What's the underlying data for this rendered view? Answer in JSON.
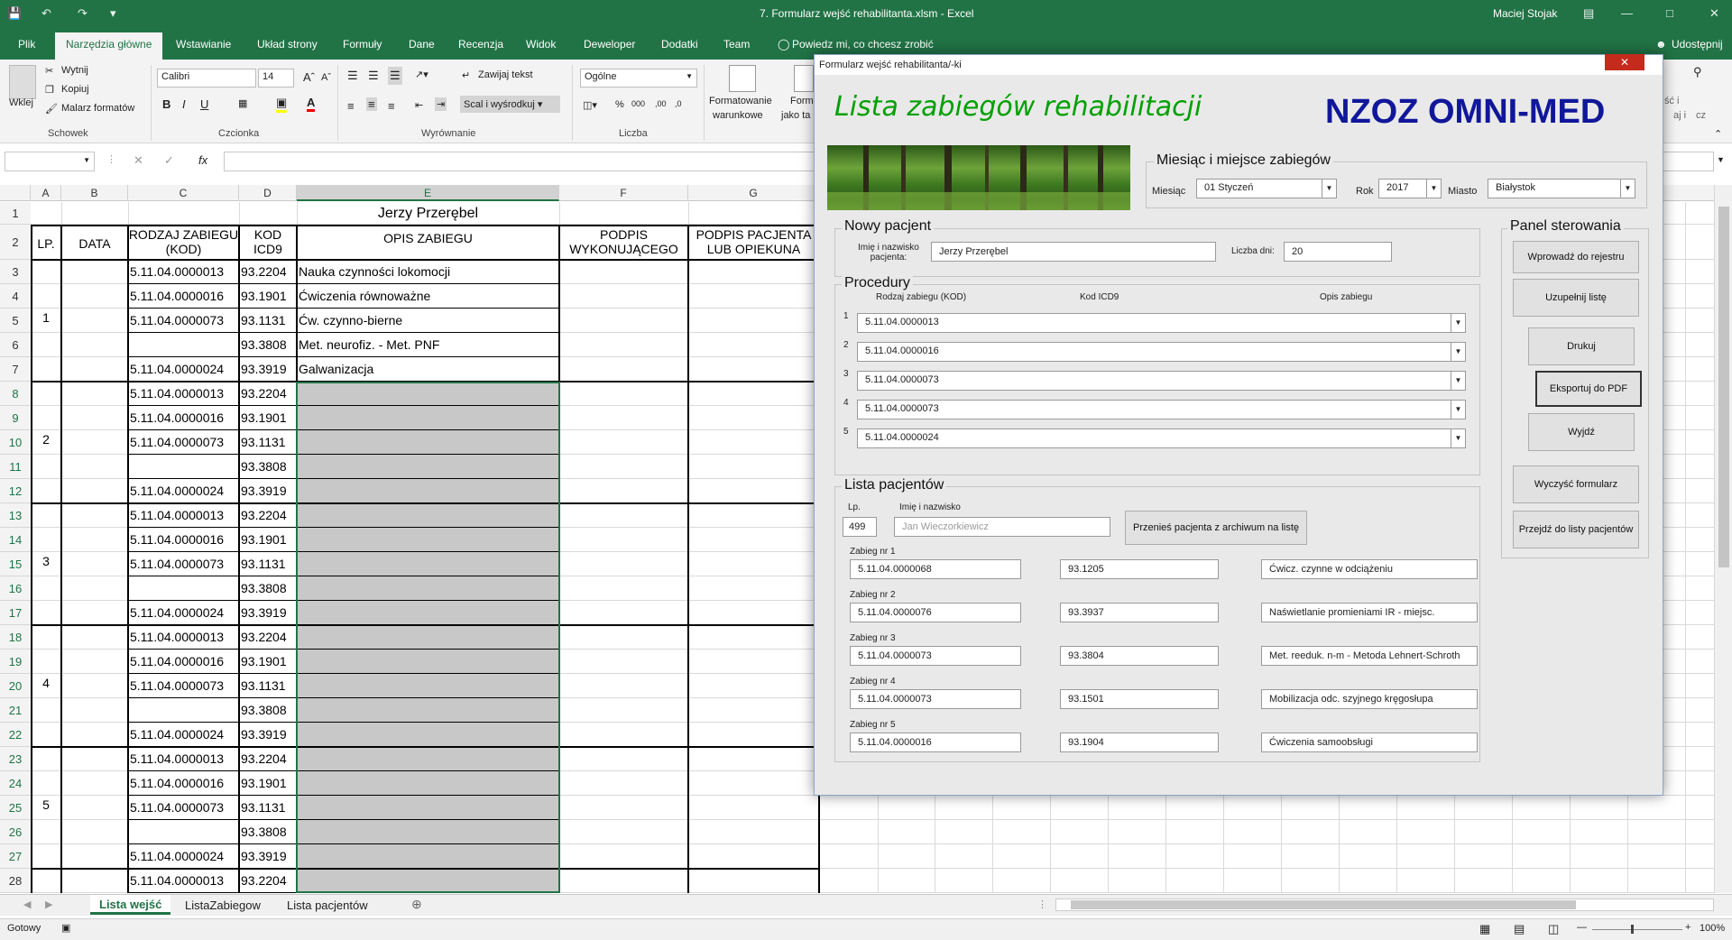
{
  "window": {
    "title": "7. Formularz wejść rehabilitanta.xlsm  -  Excel",
    "user": "Maciej Stojak"
  },
  "tabs": [
    "Plik",
    "Narzędzia główne",
    "Wstawianie",
    "Układ strony",
    "Formuły",
    "Dane",
    "Recenzja",
    "Widok",
    "Deweloper",
    "Dodatki",
    "Team"
  ],
  "tell_me": "Powiedz mi, co chcesz zrobić",
  "share": "Udostępnij",
  "ribbon": {
    "wklej": "Wklej",
    "wytnij": "Wytnij",
    "kopiuj": "Kopiuj",
    "malarz": "Malarz formatów",
    "schowek": "Schowek",
    "font_name": "Calibri",
    "font_size": "14",
    "czcionka": "Czcionka",
    "bold": "B",
    "italic": "I",
    "underline": "U",
    "zawijaj": "Zawijaj tekst",
    "scal": "Scal i wyśrodkuj",
    "wyrownanie": "Wyrównanie",
    "number_format": "Ogólne",
    "liczba": "Liczba",
    "formatowanie": "Formatowanie",
    "warunkowe": "warunkowe",
    "form": "Form",
    "jako_ta": "jako ta",
    "usun_partial": "ść i",
    "wyszuk_partial": "aj i",
    "zaznacz_partial": "cz"
  },
  "formula_bar": {
    "fx": "fx",
    "name_box": ""
  },
  "sheet": {
    "col_headers": [
      "A",
      "B",
      "C",
      "D",
      "E",
      "F",
      "G"
    ],
    "title": "Jerzy Przerębel",
    "headers": {
      "lp": "LP.",
      "data": "DATA",
      "rodzaj_1": "RODZAJ ZABIEGU",
      "rodzaj_2": "(KOD)",
      "kod_1": "KOD",
      "kod_2": "ICD9",
      "opis": "OPIS ZABIEGU",
      "podpis_w_1": "PODPIS",
      "podpis_w_2": "WYKONUJĄCEGO",
      "podpis_p_1": "PODPIS PACJENTA",
      "podpis_p_2": "LUB OPIEKUNA"
    },
    "row_numbers": [
      "1",
      "2",
      "3",
      "4",
      "5",
      "6",
      "7",
      "8",
      "9",
      "10",
      "11",
      "12",
      "13",
      "14",
      "15",
      "16",
      "17",
      "18",
      "19",
      "20",
      "21",
      "22",
      "23",
      "24",
      "25",
      "26",
      "27",
      "28"
    ],
    "groups": [
      "1",
      "2",
      "3",
      "4",
      "5"
    ],
    "rows": [
      {
        "code": "5.11.04.0000013",
        "icd": "93.2204",
        "opis": "Nauka czynności lokomocji"
      },
      {
        "code": "5.11.04.0000016",
        "icd": "93.1901",
        "opis": "Ćwiczenia równoważne"
      },
      {
        "code": "5.11.04.0000073",
        "icd": "93.1131",
        "opis": "Ćw. czynno-bierne"
      },
      {
        "code": "",
        "icd": "93.3808",
        "opis": "Met. neurofiz. - Met. PNF"
      },
      {
        "code": "5.11.04.0000024",
        "icd": "93.3919",
        "opis": "Galwanizacja"
      },
      {
        "code": "5.11.04.0000013",
        "icd": "93.2204",
        "opis": ""
      },
      {
        "code": "5.11.04.0000016",
        "icd": "93.1901",
        "opis": ""
      },
      {
        "code": "5.11.04.0000073",
        "icd": "93.1131",
        "opis": ""
      },
      {
        "code": "",
        "icd": "93.3808",
        "opis": ""
      },
      {
        "code": "5.11.04.0000024",
        "icd": "93.3919",
        "opis": ""
      },
      {
        "code": "5.11.04.0000013",
        "icd": "93.2204",
        "opis": ""
      },
      {
        "code": "5.11.04.0000016",
        "icd": "93.1901",
        "opis": ""
      },
      {
        "code": "5.11.04.0000073",
        "icd": "93.1131",
        "opis": ""
      },
      {
        "code": "",
        "icd": "93.3808",
        "opis": ""
      },
      {
        "code": "5.11.04.0000024",
        "icd": "93.3919",
        "opis": ""
      },
      {
        "code": "5.11.04.0000013",
        "icd": "93.2204",
        "opis": ""
      },
      {
        "code": "5.11.04.0000016",
        "icd": "93.1901",
        "opis": ""
      },
      {
        "code": "5.11.04.0000073",
        "icd": "93.1131",
        "opis": ""
      },
      {
        "code": "",
        "icd": "93.3808",
        "opis": ""
      },
      {
        "code": "5.11.04.0000024",
        "icd": "93.3919",
        "opis": ""
      },
      {
        "code": "5.11.04.0000013",
        "icd": "93.2204",
        "opis": ""
      },
      {
        "code": "5.11.04.0000016",
        "icd": "93.1901",
        "opis": ""
      },
      {
        "code": "5.11.04.0000073",
        "icd": "93.1131",
        "opis": ""
      },
      {
        "code": "",
        "icd": "93.3808",
        "opis": ""
      },
      {
        "code": "5.11.04.0000024",
        "icd": "93.3919",
        "opis": ""
      },
      {
        "code": "5.11.04.0000013",
        "icd": "93.2204",
        "opis": ""
      }
    ]
  },
  "sheet_tabs": [
    "Lista wejść",
    "ListaZabiegow",
    "Lista pacjentów"
  ],
  "status": {
    "ready": "Gotowy",
    "zoom": "100%"
  },
  "form": {
    "caption": "Formularz wejść rehabilitanta/-ki",
    "close": "✕",
    "heading": "Lista zabiegów rehabilitacji",
    "brand": "NZOZ OMNI-MED",
    "month_frame": "Miesiąc i miejsce zabiegów",
    "miesiac_label": "Miesiąc",
    "miesiac": "01 Styczeń",
    "rok_label": "Rok",
    "rok": "2017",
    "miasto_label": "Miasto",
    "miasto": "Białystok",
    "new_patient_frame": "Nowy pacjent",
    "name_label_1": "Imię i nazwisko",
    "name_label_2": "pacjenta:",
    "name_value": "Jerzy Przerębel",
    "days_label": "Liczba dni:",
    "days_value": "20",
    "proc_frame": "Procedury",
    "proc_col_1": "Rodzaj zabiegu (KOD)",
    "proc_col_2": "Kod ICD9",
    "proc_col_3": "Opis zabiegu",
    "procedures": [
      {
        "n": "1",
        "code": "5.11.04.0000013"
      },
      {
        "n": "2",
        "code": "5.11.04.0000016"
      },
      {
        "n": "3",
        "code": "5.11.04.0000073"
      },
      {
        "n": "4",
        "code": "5.11.04.0000073"
      },
      {
        "n": "5",
        "code": "5.11.04.0000024"
      }
    ],
    "list_frame": "Lista pacjentów",
    "lp_label": "Lp.",
    "lp_value": "499",
    "name2_label": "Imię i nazwisko",
    "name2_value": "Jan Wieczorkiewicz",
    "move_btn": "Przenieś pacjenta z archiwum na listę",
    "zabiegi": [
      {
        "label": "Zabieg nr 1",
        "code": "5.11.04.0000068",
        "icd": "93.1205",
        "opis": "Ćwicz. czynne w odciążeniu"
      },
      {
        "label": "Zabieg nr 2",
        "code": "5.11.04.0000076",
        "icd": "93.3937",
        "opis": "Naświetlanie promieniami IR - miejsc."
      },
      {
        "label": "Zabieg nr 3",
        "code": "5.11.04.0000073",
        "icd": "93.3804",
        "opis": "Met. reeduk. n-m - Metoda Lehnert-Schroth"
      },
      {
        "label": "Zabieg nr 4",
        "code": "5.11.04.0000073",
        "icd": "93.1501",
        "opis": "Mobilizacja odc. szyjnego kręgosłupa"
      },
      {
        "label": "Zabieg nr 5",
        "code": "5.11.04.0000016",
        "icd": "93.1904",
        "opis": "Ćwiczenia samoobsługi"
      }
    ],
    "panel_frame": "Panel sterowania",
    "buttons": [
      "Wprowadź do rejestru",
      "Uzupełnij listę",
      "Drukuj",
      "Eksportuj do PDF",
      "Wyjdź",
      "Wyczyść formularz",
      "Przejdź do listy pacjentów"
    ],
    "colors": {
      "heading": "#00a000",
      "brand": "#10179a",
      "excel_green": "#217346"
    }
  }
}
